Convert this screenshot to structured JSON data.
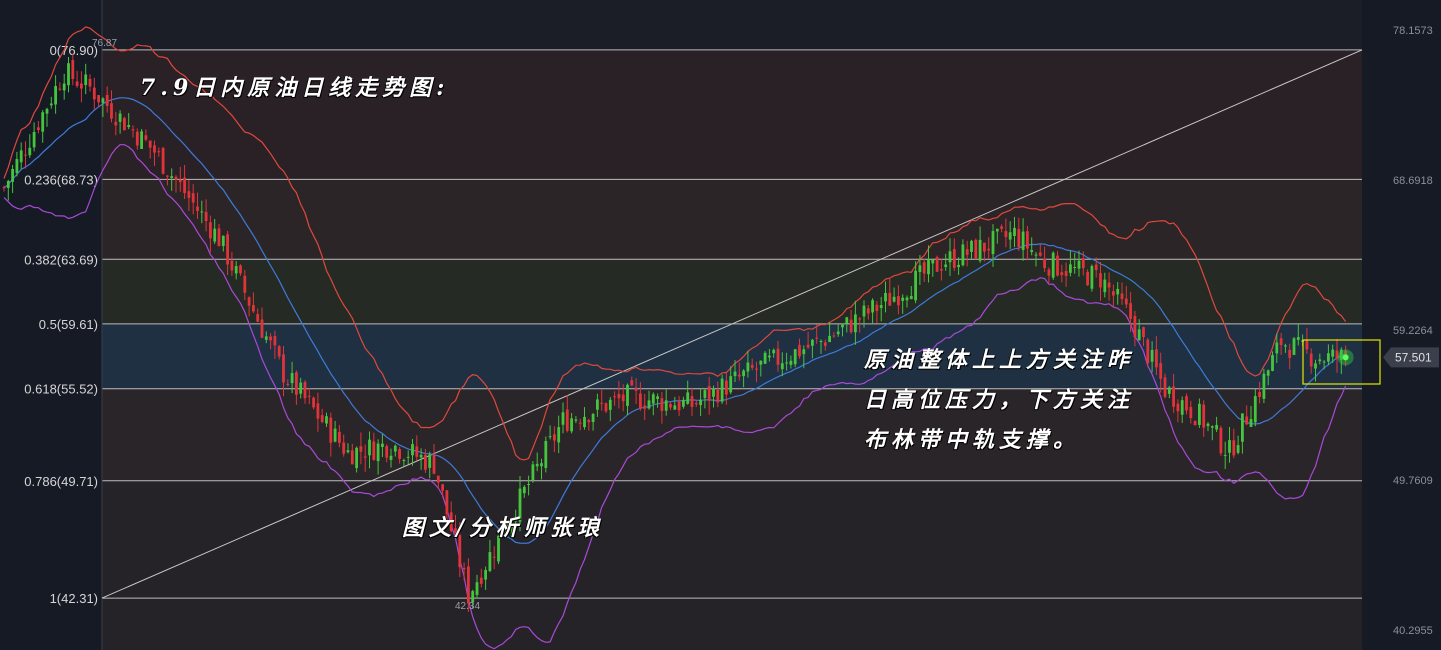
{
  "chart_data": {
    "type": "candlestick",
    "title": "7.9日内原油日线走势图:",
    "ylim": [
      40.2955,
      78.1573
    ],
    "right_axis_ticks": [
      78.1573,
      68.6918,
      59.2264,
      49.7609,
      40.2955
    ],
    "current_price": "57.501",
    "high_label": "76.87",
    "low_label": "42.34",
    "fibonacci": [
      {
        "label": "0(76.90)",
        "value": 76.9
      },
      {
        "label": "0.236(68.73)",
        "value": 68.73
      },
      {
        "label": "0.382(63.69)",
        "value": 63.69
      },
      {
        "label": "0.5(59.61)",
        "value": 59.61
      },
      {
        "label": "0.618(55.52)",
        "value": 55.52
      },
      {
        "label": "0.786(49.71)",
        "value": 49.71
      },
      {
        "label": "1(42.31)",
        "value": 42.31
      }
    ],
    "key_closes": [
      [
        0,
        68.2
      ],
      [
        14,
        75.5
      ],
      [
        20,
        74.5
      ],
      [
        35,
        70.5
      ],
      [
        50,
        65.0
      ],
      [
        65,
        56.5
      ],
      [
        80,
        51.5
      ],
      [
        90,
        52.0
      ],
      [
        100,
        50.8
      ],
      [
        108,
        42.5
      ],
      [
        115,
        46.0
      ],
      [
        130,
        53.5
      ],
      [
        145,
        55.0
      ],
      [
        160,
        54.5
      ],
      [
        175,
        56.8
      ],
      [
        190,
        58.5
      ],
      [
        205,
        61.0
      ],
      [
        218,
        63.5
      ],
      [
        228,
        64.5
      ],
      [
        235,
        65.3
      ],
      [
        242,
        63.5
      ],
      [
        255,
        62.5
      ],
      [
        262,
        60.0
      ],
      [
        270,
        55.5
      ],
      [
        278,
        53.8
      ],
      [
        285,
        51.5
      ],
      [
        292,
        55.5
      ],
      [
        297,
        58.5
      ],
      [
        305,
        57.5
      ],
      [
        312,
        57.5
      ]
    ],
    "candle_count": 313,
    "series": [
      {
        "role": "bollinger-upper",
        "color": "#e0483c"
      },
      {
        "role": "bollinger-middle",
        "color": "#3d7bd9"
      },
      {
        "role": "bollinger-lower",
        "color": "#a94ad6"
      }
    ],
    "colors": {
      "up": "#45c43e",
      "down": "#e0343a",
      "background": "#161a25"
    }
  },
  "annotations": {
    "watermark": "图文/分析师张琅",
    "commentary": "原油整体上上方关注昨\n日高位压力，下方关注\n布林带中轨支撑。"
  }
}
